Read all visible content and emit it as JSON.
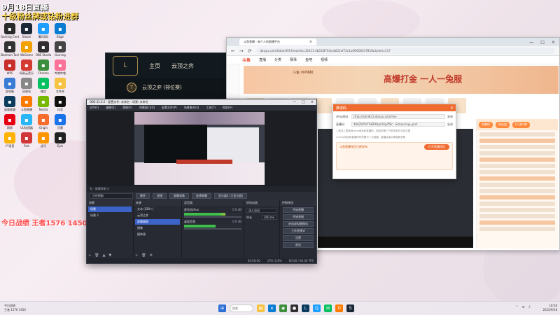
{
  "overlay": {
    "title": "9月18日直播",
    "subtitle": "十级粉丝牌或钻粉进群",
    "stat": "今日战绩 王者1576 1450"
  },
  "desktop_icons": [
    {
      "label": "Gaming Center",
      "icon": "gaming-icon",
      "color": "#2a2a2a"
    },
    {
      "label": "Steam",
      "icon": "steam-icon",
      "color": "#1b2838"
    },
    {
      "label": "腾讯QQ",
      "icon": "qq-icon",
      "color": "#1e9fff"
    },
    {
      "label": "Edge",
      "icon": "edge-icon",
      "color": "#0a7cd1"
    },
    {
      "label": "Daemon Tools",
      "icon": "daemon-icon",
      "color": "#333"
    },
    {
      "label": "WeGame",
      "icon": "wegame-icon",
      "color": "#f2a100"
    },
    {
      "label": "OBS Studio",
      "icon": "obs-icon",
      "color": "#302e31"
    },
    {
      "label": "Gaming",
      "icon": "controller-icon",
      "color": "#444"
    },
    {
      "label": "WPS",
      "icon": "wps-icon",
      "color": "#c8302c"
    },
    {
      "label": "网易云音乐",
      "icon": "music-icon",
      "color": "#d43c33"
    },
    {
      "label": "Chrome",
      "icon": "chrome-icon",
      "color": "#3c8d3c"
    },
    {
      "label": "哔哩哔哩",
      "icon": "bilibili-icon",
      "color": "#fb7299"
    },
    {
      "label": "此电脑",
      "icon": "computer-icon",
      "color": "#3a7bd5"
    },
    {
      "label": "回收站",
      "icon": "recycle-icon",
      "color": "#888"
    },
    {
      "label": "微信",
      "icon": "wechat-icon",
      "color": "#07c160"
    },
    {
      "label": "文件夹",
      "icon": "folder-icon",
      "color": "#f5c242"
    },
    {
      "label": "英雄联盟",
      "icon": "lol-icon",
      "color": "#0b3c5d"
    },
    {
      "label": "斗鱼直播",
      "icon": "douyu-icon",
      "color": "#ff7a00"
    },
    {
      "label": "Nvidia",
      "icon": "nvidia-icon",
      "color": "#76b900"
    },
    {
      "label": "抖音",
      "icon": "tiktok-icon",
      "color": "#111"
    },
    {
      "label": "网易",
      "icon": "netease-icon",
      "color": "#e60012"
    },
    {
      "label": "UU加速器",
      "icon": "uu-icon",
      "color": "#29b6f6"
    },
    {
      "label": "Origin",
      "icon": "origin-icon",
      "color": "#f56c2d"
    },
    {
      "label": "迅雷",
      "icon": "thunder-icon",
      "color": "#1a73e8"
    },
    {
      "label": "YY语音",
      "icon": "yy-icon",
      "color": "#ffb300"
    },
    {
      "label": "Riot",
      "icon": "riot-icon",
      "color": "#d13639"
    },
    {
      "label": "虎牙",
      "icon": "huya-icon",
      "color": "#ff9600"
    },
    {
      "label": "Epic",
      "icon": "epic-icon",
      "color": "#222"
    }
  ],
  "lol_client": {
    "logo": "L",
    "tabs": [
      "主页",
      "云顶之弈"
    ],
    "mode_text": "云顶之弈 (排位赛)"
  },
  "browser": {
    "tab_title": "斗鱼直播 - 每个人的直播平台",
    "url": "douyu.com/4iduin691#roomId=32411-4b55/8754ceb622af72e1a/9000001785/&dyded=517",
    "header": {
      "logo": "斗鱼",
      "nav": [
        "直播",
        "分类",
        "赛事",
        "鱼吧",
        "视频"
      ],
      "search_placeholder": "搜索"
    },
    "banner": {
      "left_text": "斗鱼 VIP特权",
      "slogan": "高爆打金 一人一兔服"
    },
    "chat": {
      "tabs": [
        "贡献榜",
        "粉丝团"
      ],
      "rank_chip": "FC用户群"
    }
  },
  "dialog": {
    "title": "推流码",
    "close": "×",
    "rows": [
      {
        "label": "rtmp地址",
        "value": "rtmp://sendtc3.douyu.com/live",
        "action": "复制"
      },
      {
        "label": "直播码",
        "value": "4662929rTG8EXbrpV4g7f8c...&dsouring=prol",
        "action": "复制"
      }
    ],
    "notes": [
      "1.推流工具使用rtmp地址和直播码，粘贴到第三方推流软件对应位置",
      "2.rtmp地址和直播码有效期为一次直播，直播结束后需重新获取"
    ],
    "tip_title": "斗鱼直播伴侣已经发布",
    "tip_button": "打开直播伴侣"
  },
  "obs": {
    "title": "OBS 31.0.2 - 配置文件: 未命名 - 场景: 未命名",
    "window_controls": [
      "—",
      "□",
      "×"
    ],
    "menu": [
      "文件(F)",
      "编辑(E)",
      "视图(V)",
      "停靠窗口(D)",
      "配置文件(P)",
      "场景集合(S)",
      "工具(T)",
      "帮助(H)"
    ],
    "strip_text": "无 · 屏幕录制 2",
    "source_selector": "正在抓取",
    "toolbar_buttons": [
      "属性",
      "滤镜",
      "屏幕录像",
      "选择屏幕",
      "显示器1 (主显示器)"
    ],
    "docks": {
      "scenes": {
        "title": "场景",
        "items": [
          "场景",
          "场景 2"
        ],
        "selected": 0
      },
      "sources": {
        "title": "来源",
        "items": [
          "文本 (GDI+)",
          "云顶之弈",
          "屏幕捕获",
          "图像",
          "媒体源"
        ],
        "selected": 2
      },
      "mixer": {
        "title": "混音器",
        "channels": [
          {
            "name": "麦克风/Aux",
            "db": "0.0 dB",
            "level": 0.72
          },
          {
            "name": "桌面音频",
            "db": "0.0 dB",
            "level": 0.55
          }
        ]
      },
      "transitions": {
        "title": "转场动画",
        "type": "淡入淡出",
        "duration_label": "时长",
        "duration": "300 ms"
      },
      "controls": {
        "title": "控制按钮",
        "buttons": [
          "开始直播",
          "开始录制",
          "启动虚拟摄像机",
          "工作室模式",
          "设置",
          "退出"
        ]
      }
    },
    "status": {
      "cpu": "CPU: 0.8%",
      "fps": "60.00 / 60.00 FPS",
      "time": "00:00:00"
    }
  },
  "taskbar": {
    "left_line1": "今日战绩",
    "left_line2": "王者 1576 1450",
    "search": "搜索",
    "time": "18:58",
    "date": "2025/9/18"
  }
}
